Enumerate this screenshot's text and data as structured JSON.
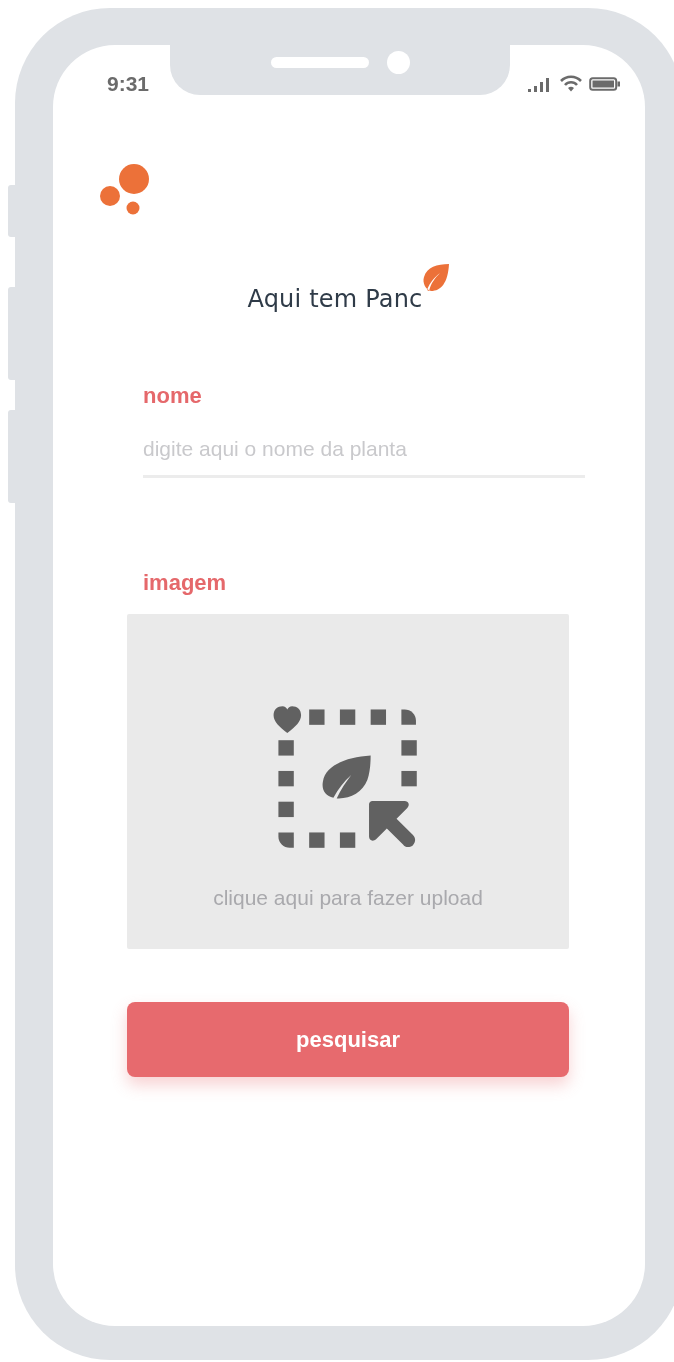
{
  "status_bar": {
    "time": "9:31"
  },
  "app": {
    "title": "Aqui tem Panc"
  },
  "fields": [
    {
      "label": "nome",
      "placeholder": "digite aqui o nome da planta"
    }
  ],
  "image_upload": {
    "label": "imagem",
    "hint": "clique aqui para fazer upload"
  },
  "button": {
    "label": "pesquisar"
  }
}
